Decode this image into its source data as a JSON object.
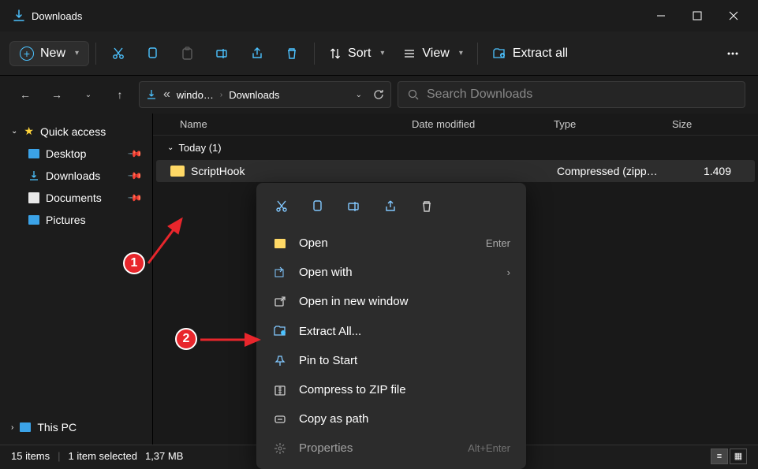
{
  "titlebar": {
    "title": "Downloads"
  },
  "toolbar": {
    "new_label": "New",
    "sort_label": "Sort",
    "view_label": "View",
    "extract_label": "Extract all"
  },
  "breadcrumb": {
    "segment1": "windo…",
    "segment2": "Downloads"
  },
  "search": {
    "placeholder": "Search Downloads"
  },
  "sidebar": {
    "quick_access": "Quick access",
    "items": [
      {
        "label": "Desktop"
      },
      {
        "label": "Downloads"
      },
      {
        "label": "Documents"
      },
      {
        "label": "Pictures"
      }
    ],
    "this_pc": "This PC"
  },
  "columns": {
    "name": "Name",
    "date": "Date modified",
    "type": "Type",
    "size": "Size"
  },
  "group_today": "Today (1)",
  "file": {
    "name": "ScriptHook",
    "type": "Compressed (zipp…",
    "size": "1.409"
  },
  "context_menu": {
    "open": "Open",
    "open_shortcut": "Enter",
    "open_with": "Open with",
    "open_new_window": "Open in new window",
    "extract_all": "Extract All...",
    "pin_start": "Pin to Start",
    "compress": "Compress to ZIP file",
    "copy_path": "Copy as path",
    "properties": "Properties",
    "properties_shortcut": "Alt+Enter"
  },
  "status": {
    "items": "15 items",
    "selected": "1 item selected",
    "size": "1,37 MB"
  },
  "callouts": {
    "one": "1",
    "two": "2"
  }
}
